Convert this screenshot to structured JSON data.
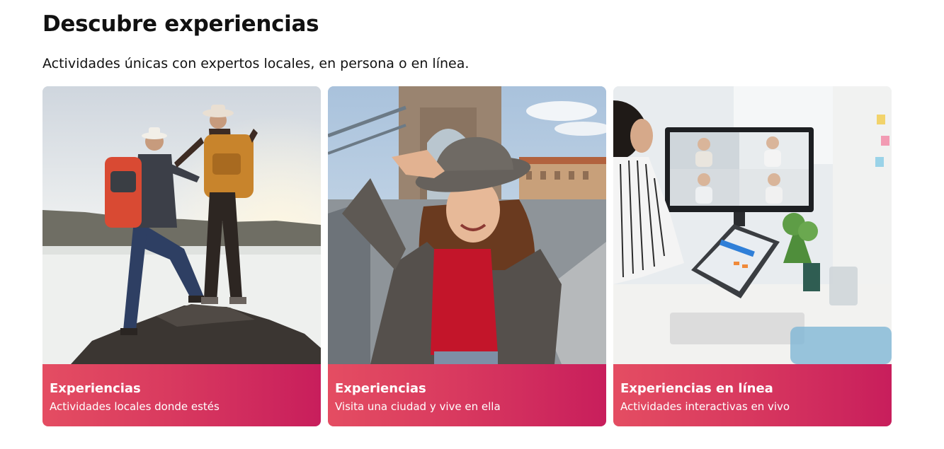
{
  "section": {
    "title": "Descubre experiencias",
    "subtitle": "Actividades únicas con expertos locales, en persona o en línea."
  },
  "cards": [
    {
      "title": "Experiencias",
      "description": "Actividades locales donde estés",
      "image": "hikers-on-rock-photo"
    },
    {
      "title": "Experiencias",
      "description": "Visita una ciudad y vive en ella",
      "image": "woman-in-hat-on-bridge-photo"
    },
    {
      "title": "Experiencias en línea",
      "description": "Actividades interactivas en vivo",
      "image": "video-call-office-photo"
    }
  ],
  "colors": {
    "card_gradient_start": "#e44d62",
    "card_gradient_end": "#c81e5c",
    "text_primary": "#111111",
    "card_text": "#ffffff"
  }
}
